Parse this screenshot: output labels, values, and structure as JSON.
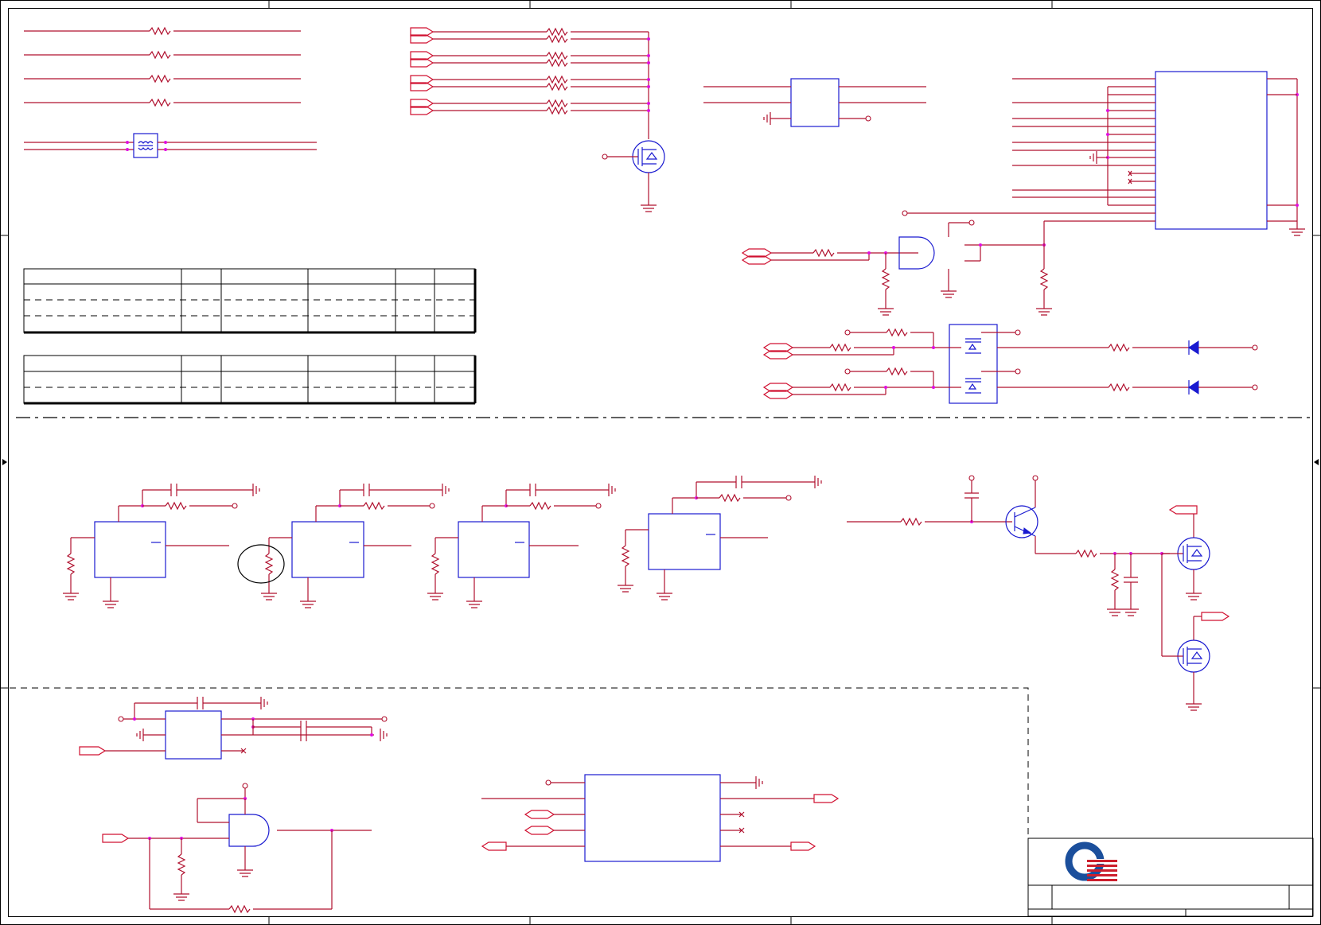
{
  "document": {
    "type": "schematic-sheet",
    "title_block": {
      "logo": "quanta-logo",
      "brand_color": "#cc1f2d",
      "accent_color": "#1b4f9c"
    }
  },
  "colors": {
    "wire": "#b0102e",
    "component_outline": "#1a1ad0",
    "junction": "#e010e0",
    "border": "#000000"
  },
  "tables": [
    {
      "rows": 3,
      "columns": 6
    },
    {
      "rows": 2,
      "columns": 6
    }
  ]
}
